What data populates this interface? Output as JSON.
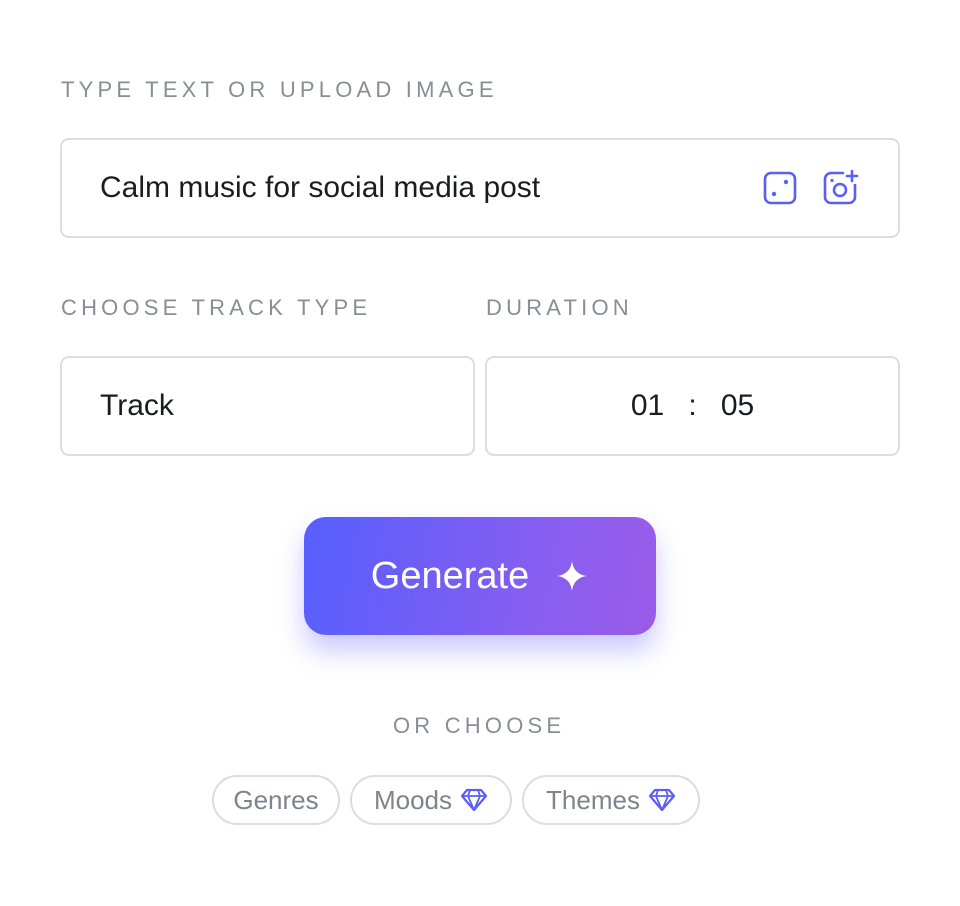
{
  "prompt": {
    "label": "TYPE TEXT OR UPLOAD IMAGE",
    "value": "Calm music for social media post",
    "icons": [
      "dice-icon",
      "add-photo-icon"
    ]
  },
  "track_type": {
    "label": "CHOOSE TRACK TYPE",
    "value": "Track"
  },
  "duration": {
    "label": "DURATION",
    "minutes": "01",
    "separator": ":",
    "seconds": "05"
  },
  "generate": {
    "label": "Generate",
    "icon": "sparkle-icon"
  },
  "or_choose": {
    "label": "OR CHOOSE",
    "chips": [
      {
        "label": "Genres",
        "icon": ""
      },
      {
        "label": "Moods",
        "icon": "diamond-icon"
      },
      {
        "label": "Themes",
        "icon": "diamond-icon"
      }
    ]
  },
  "colors": {
    "accent": "#5b5ff6",
    "gradient_start": "#565ffe",
    "gradient_end": "#9a5be8",
    "label_gray": "#8a8c96",
    "border": "#dcdde1"
  }
}
